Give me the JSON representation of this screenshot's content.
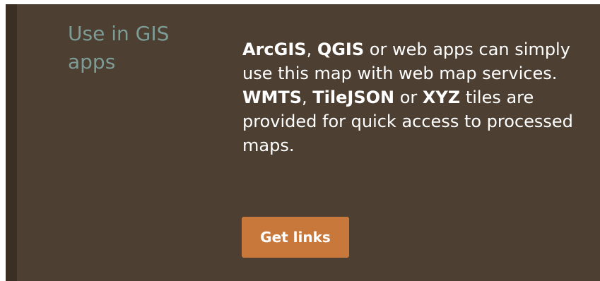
{
  "section": {
    "title": "Use in GIS apps",
    "paragraph1": {
      "b1": "ArcGIS",
      "t1": ", ",
      "b2": "QGIS",
      "t2": " or web apps can simply use this map with web map services."
    },
    "paragraph2": {
      "b1": "WMTS",
      "t1": ", ",
      "b2": "TileJSON",
      "t2": " or ",
      "b3": "XYZ",
      "t3": " tiles are provided for quick access to processed maps."
    }
  },
  "button": {
    "label": "Get links"
  },
  "colors": {
    "frame": "#3b2e22",
    "panel": "#4d3f31",
    "title": "#7e9c96",
    "text": "#ffffff",
    "button": "#c8783a"
  }
}
